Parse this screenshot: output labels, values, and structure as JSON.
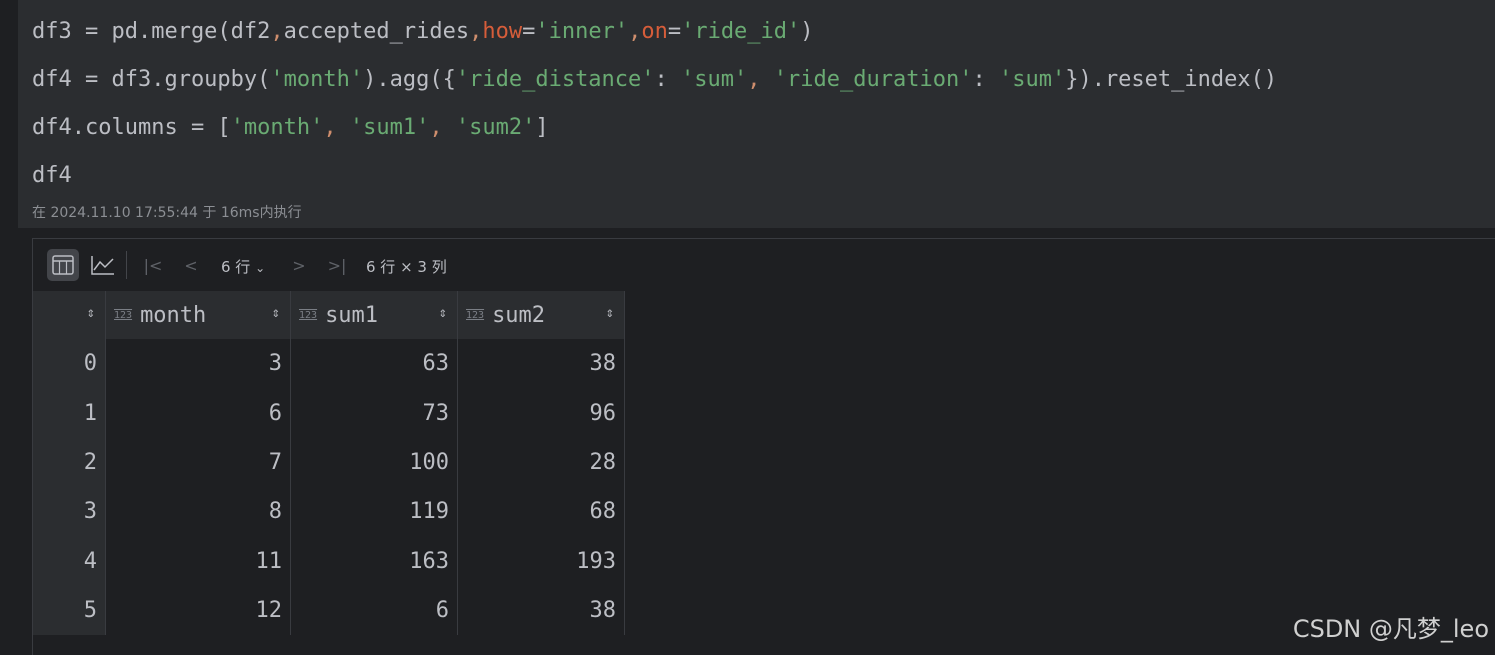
{
  "code": {
    "lines": [
      [
        {
          "t": "df3 = pd.merge(df2",
          "c": ""
        },
        {
          "t": ",",
          "c": "kw"
        },
        {
          "t": "accepted_rides",
          "c": ""
        },
        {
          "t": ",",
          "c": "kw"
        },
        {
          "t": "how",
          "c": "ni"
        },
        {
          "t": "=",
          "c": ""
        },
        {
          "t": "'inner'",
          "c": "str"
        },
        {
          "t": ",",
          "c": "kw"
        },
        {
          "t": "on",
          "c": "ni"
        },
        {
          "t": "=",
          "c": ""
        },
        {
          "t": "'ride_id'",
          "c": "str"
        },
        {
          "t": ")",
          "c": ""
        }
      ],
      [
        {
          "t": "df4 = df3.groupby(",
          "c": ""
        },
        {
          "t": "'month'",
          "c": "str"
        },
        {
          "t": ").agg({",
          "c": ""
        },
        {
          "t": "'ride_distance'",
          "c": "str"
        },
        {
          "t": ": ",
          "c": ""
        },
        {
          "t": "'sum'",
          "c": "str"
        },
        {
          "t": ", ",
          "c": "kw"
        },
        {
          "t": "'ride_duration'",
          "c": "str"
        },
        {
          "t": ": ",
          "c": ""
        },
        {
          "t": "'sum'",
          "c": "str"
        },
        {
          "t": "}).reset_index()",
          "c": ""
        }
      ],
      [
        {
          "t": "df4.columns = [",
          "c": ""
        },
        {
          "t": "'month'",
          "c": "str"
        },
        {
          "t": ", ",
          "c": "kw"
        },
        {
          "t": "'sum1'",
          "c": "str"
        },
        {
          "t": ", ",
          "c": "kw"
        },
        {
          "t": "'sum2'",
          "c": "str"
        },
        {
          "t": "]",
          "c": ""
        }
      ],
      [
        {
          "t": "df4",
          "c": ""
        }
      ]
    ],
    "exec_info": "在 2024.11.10 17:55:44 于 16ms内执行"
  },
  "toolbar": {
    "rows_selector": "6 行",
    "dimensions": "6 行 × 3 列",
    "icons": [
      "table-view-icon",
      "chart-view-icon",
      "first-page-icon",
      "prev-page-icon",
      "chevron-down-icon",
      "next-page-icon",
      "last-page-icon"
    ]
  },
  "table": {
    "columns": [
      {
        "name": "month",
        "type_icon": "123"
      },
      {
        "name": "sum1",
        "type_icon": "123"
      },
      {
        "name": "sum2",
        "type_icon": "123"
      }
    ],
    "rows": [
      {
        "index": "0",
        "values": [
          "3",
          "63",
          "38"
        ]
      },
      {
        "index": "1",
        "values": [
          "6",
          "73",
          "96"
        ]
      },
      {
        "index": "2",
        "values": [
          "7",
          "100",
          "28"
        ]
      },
      {
        "index": "3",
        "values": [
          "8",
          "119",
          "68"
        ]
      },
      {
        "index": "4",
        "values": [
          "11",
          "163",
          "193"
        ]
      },
      {
        "index": "5",
        "values": [
          "12",
          "6",
          "38"
        ]
      }
    ]
  },
  "watermark": "CSDN @凡梦_leo",
  "colors": {
    "background": "#1e1f22",
    "editor_bg": "#2b2d30",
    "string": "#6aab73",
    "keyword": "#cf8e6d",
    "named_arg": "#d65d3a",
    "text": "#bcbec4"
  }
}
